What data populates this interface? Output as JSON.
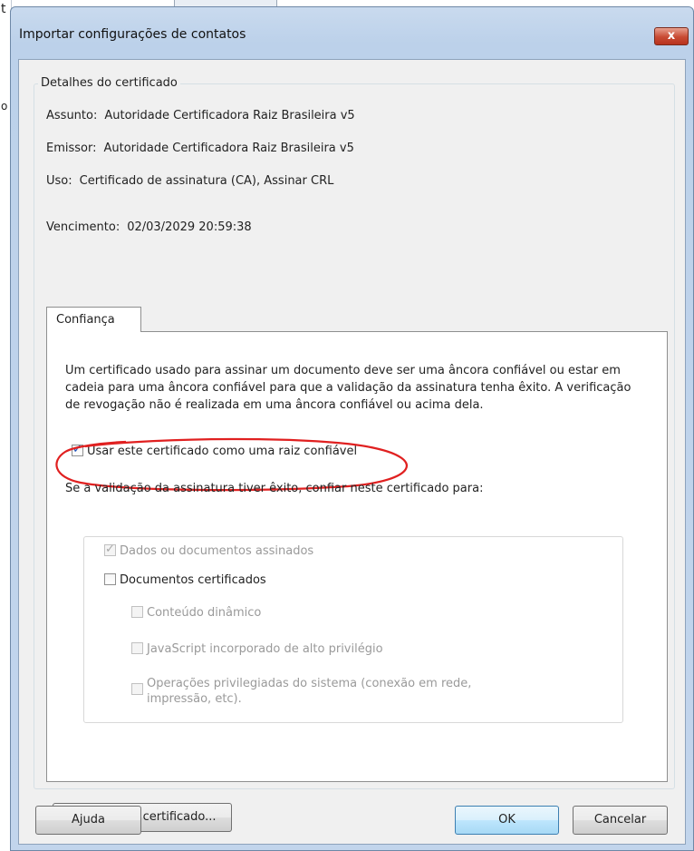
{
  "background": {
    "fragments": [
      "t",
      "o"
    ]
  },
  "dialog": {
    "title": "Importar configurações de contatos",
    "close_label": "x",
    "cert_group": {
      "legend": "Detalhes do certificado",
      "subject_label": "Assunto:",
      "subject_value": "Autoridade Certificadora Raiz Brasileira v5",
      "issuer_label": "Emissor:",
      "issuer_value": "Autoridade Certificadora Raiz Brasileira v5",
      "usage_label": "Uso:",
      "usage_value": "Certificado de assinatura (CA), Assinar CRL",
      "expiry_label": "Vencimento:",
      "expiry_value": "02/03/2029 20:59:38"
    },
    "tab": {
      "label": "Confiança",
      "paragraph": "Um certificado usado para assinar um documento deve ser uma âncora confiável ou estar em cadeia para uma âncora confiável para que a validação da assinatura tenha êxito. A verificação de revogação não é realizada em uma âncora confiável ou acima dela.",
      "trusted_root": {
        "label": "Usar este certificado como uma raiz confiável",
        "checked": true
      },
      "trust_for": "Se a validação da assinatura tiver êxito, confiar neste certificado para:",
      "options": [
        {
          "label": "Dados ou documentos assinados",
          "checked": true,
          "disabled": true
        },
        {
          "label": "Documentos certificados",
          "checked": false,
          "disabled": false
        },
        {
          "label": "Conteúdo dinâmico",
          "checked": false,
          "disabled": true
        },
        {
          "label": "JavaScript incorporado de alto privilégio",
          "checked": false,
          "disabled": true
        },
        {
          "label": "Operações privilegiadas do sistema (conexão em rede, impressão, etc).",
          "checked": false,
          "disabled": true
        }
      ]
    },
    "buttons": {
      "details": "Detalhes do certificado...",
      "help": "Ajuda",
      "ok": "OK",
      "cancel": "Cancelar"
    },
    "annotation_color": "#e02020"
  }
}
